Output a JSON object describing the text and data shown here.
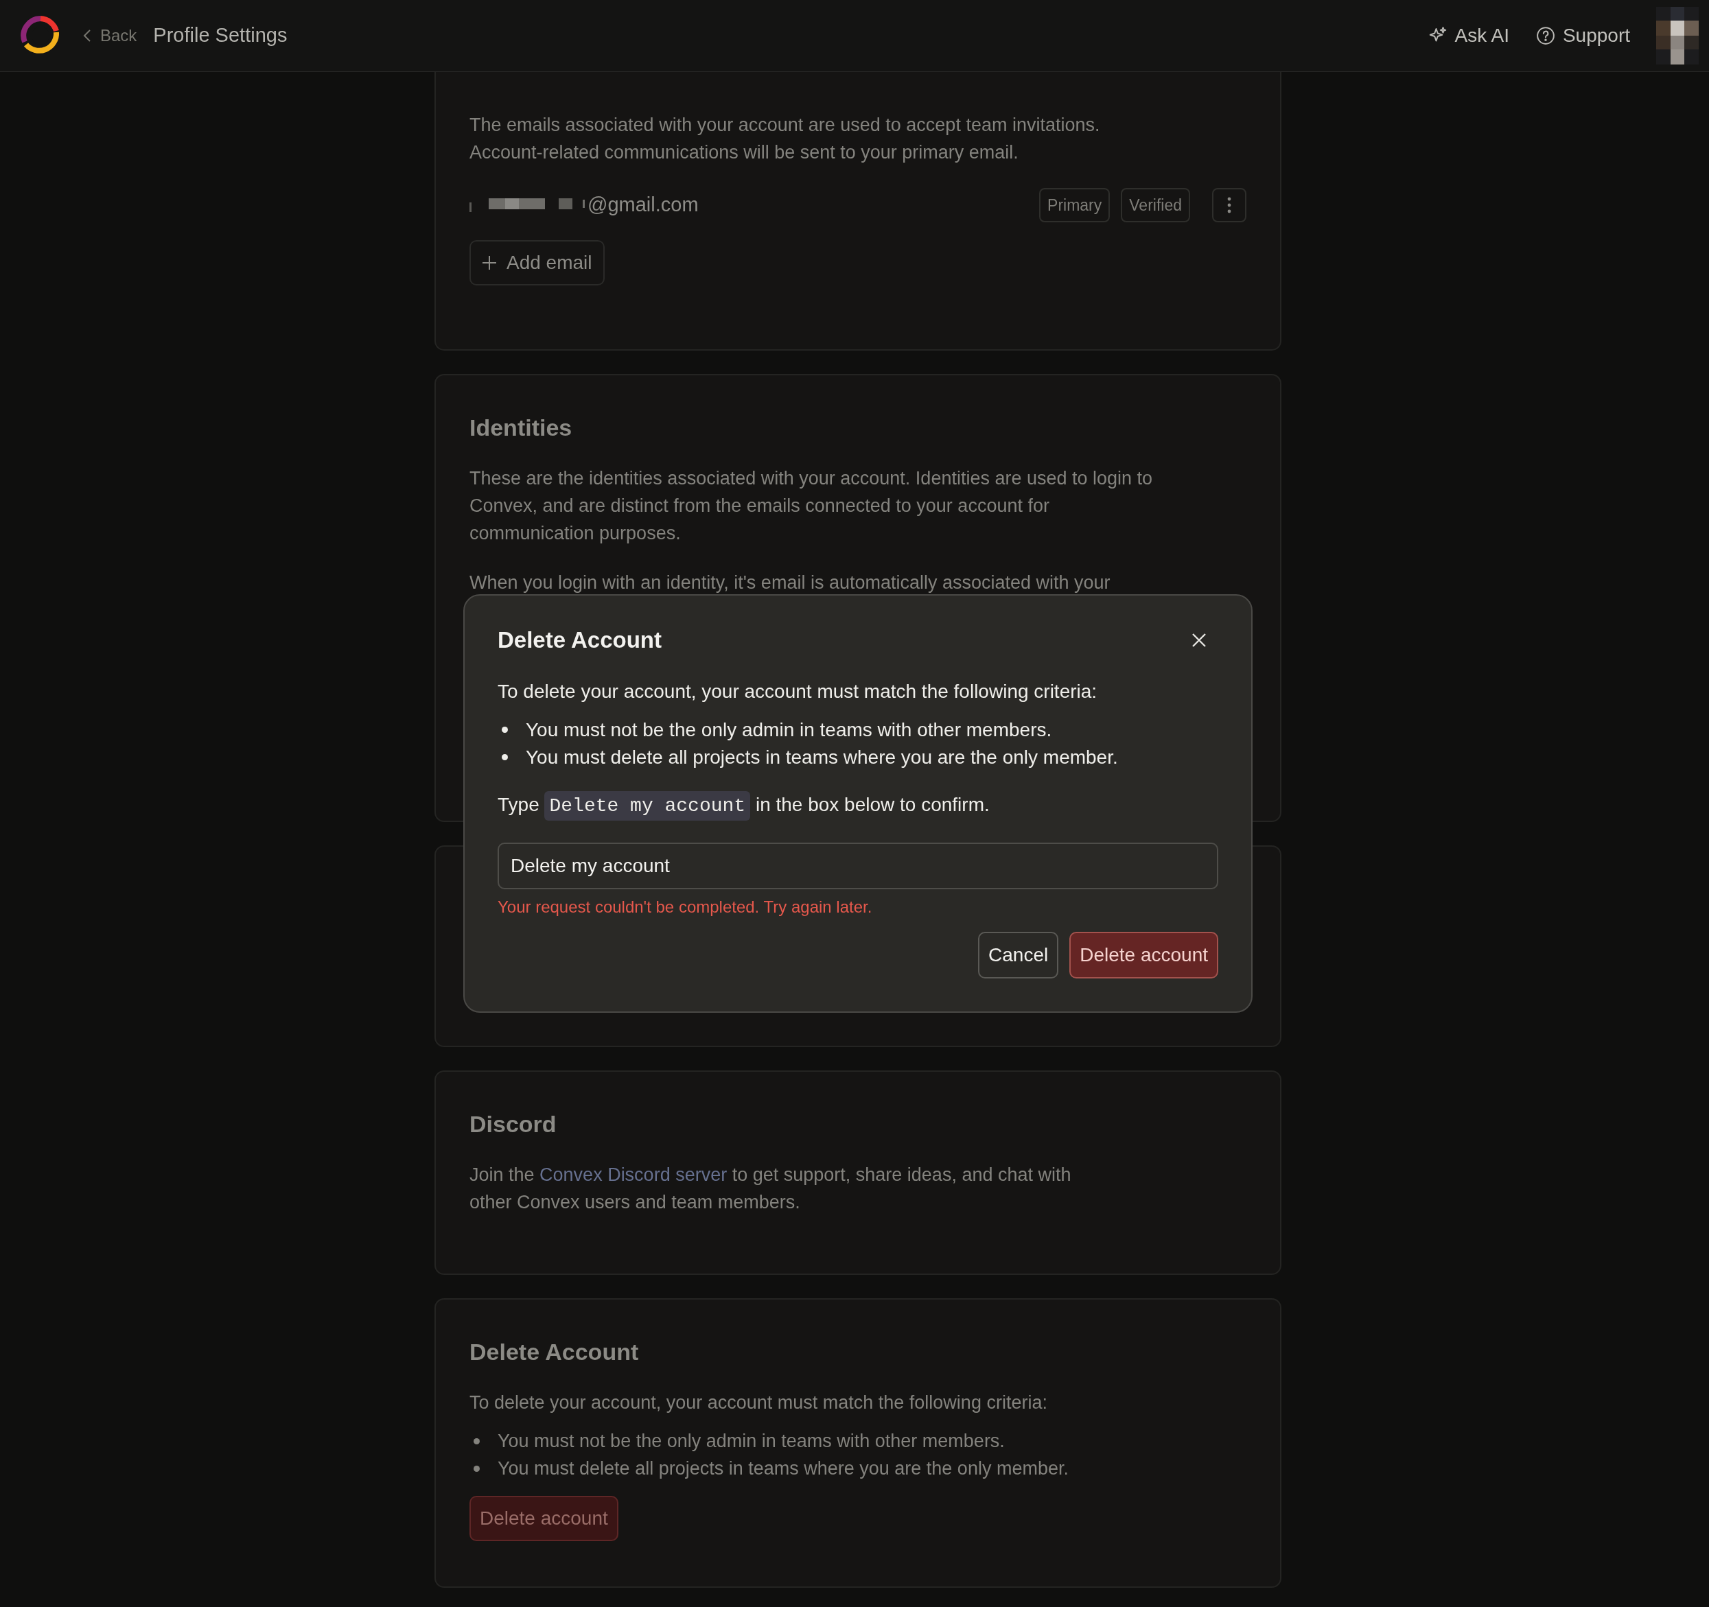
{
  "header": {
    "back": "Back",
    "title": "Profile Settings",
    "actions": [
      {
        "label": "Ask AI"
      },
      {
        "label": "Support"
      }
    ]
  },
  "sections": [
    {
      "kind": "emails",
      "lines": [
        "The emails associated with your account are used to accept team invitations.",
        "Account-related communications will be sent to your primary email."
      ],
      "emails": [
        {
          "address": "@gmail.com",
          "redacted": true,
          "badges": [
            "Primary",
            "Verified"
          ]
        }
      ],
      "add_button": "Add email"
    },
    {
      "kind": "text",
      "title": "Identities",
      "paragraphs": [
        [
          "These are the identities associated with your account. Identities are used to login to",
          "Convex, and are distinct from the emails connected to your account for",
          "communication purposes."
        ],
        [
          "When you login with an identity, it's email is automatically associated with your"
        ]
      ]
    },
    {
      "kind": "blank"
    },
    {
      "kind": "link_text",
      "title": "Discord",
      "before": "Join the ",
      "link": "Convex Discord server",
      "after": " to get support, share ideas, and chat with",
      "line_2": "other Convex users and team members."
    },
    {
      "kind": "danger",
      "title": "Delete Account",
      "intro": "To delete your account, your account must match the following criteria:",
      "criteria": [
        "You must not be the only admin in teams with other members.",
        "You must delete all projects in teams where you are the only member."
      ],
      "button": "Delete account"
    }
  ],
  "dialog": {
    "title": "Delete Account",
    "intro": "To delete your account, your account must match the following criteria:",
    "criteria": [
      "You must not be the only admin in teams with other members.",
      "You must delete all projects in teams where you are the only member."
    ],
    "confirm": {
      "before": "Type ",
      "code": "Delete my account",
      "after": " in the box below to confirm."
    },
    "input_value": "Delete my account",
    "error": "Your request couldn't be completed. Try again later.",
    "buttons": [
      {
        "label": "Cancel",
        "kind": "secondary"
      },
      {
        "label": "Delete account",
        "kind": "danger"
      }
    ]
  }
}
